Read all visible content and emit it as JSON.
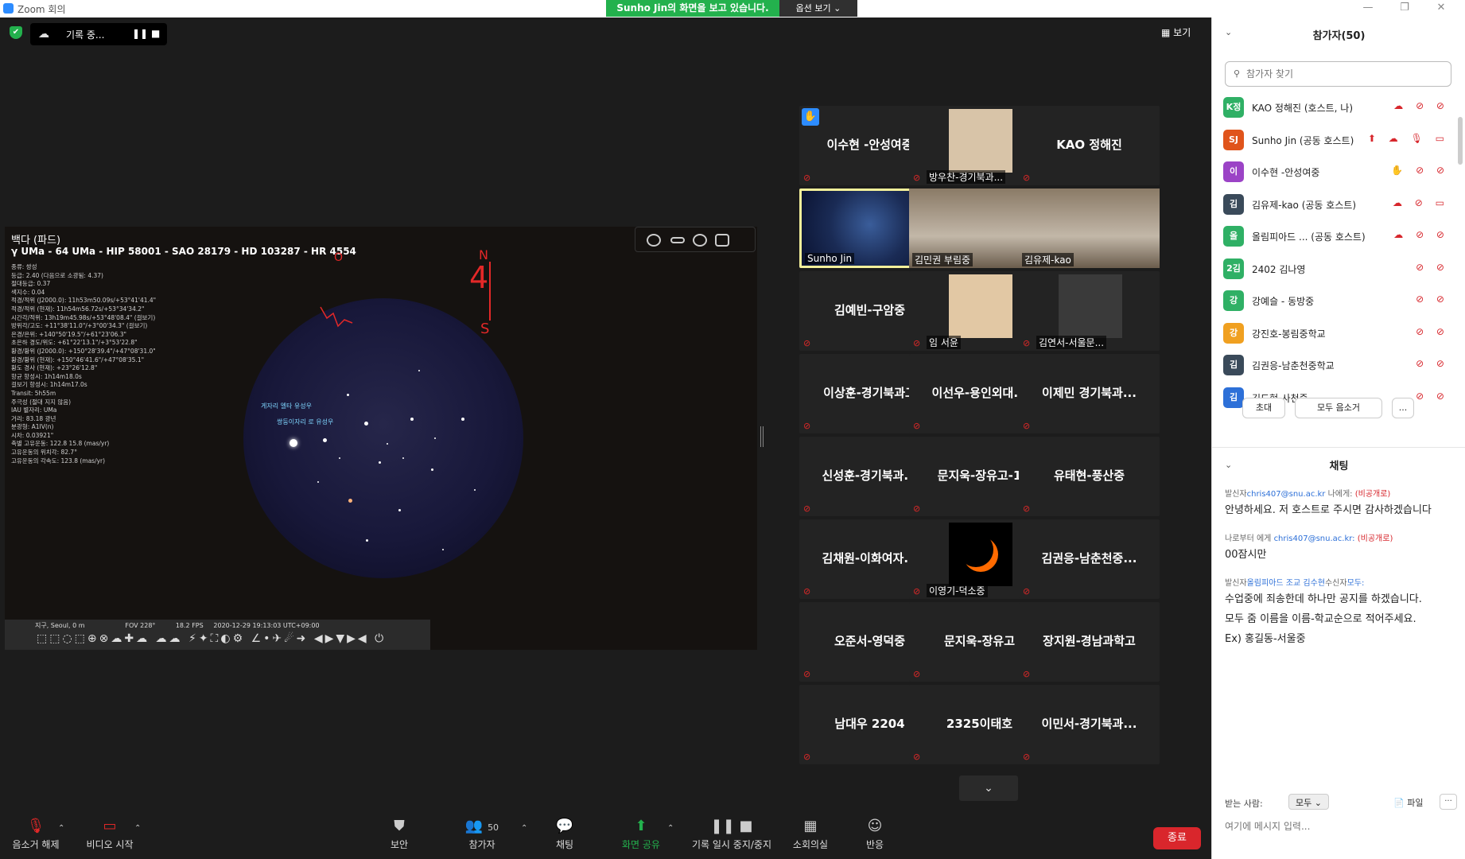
{
  "window": {
    "title": "Zoom 회의",
    "share_banner": "Sunho Jin의 화면을 보고 있습니다.",
    "view_options": "옵션 보기 ⌄",
    "minimize_glyph": "—",
    "restore_glyph": "❐",
    "close_glyph": "✕"
  },
  "recording": {
    "label": "기록 중...",
    "pause_glyph": "❚❚",
    "stop_glyph": "■"
  },
  "view_button": "보기",
  "shared_screen": {
    "object_title": "백다 (파드)",
    "object_ids": "γ UMa - 64 UMa - HIP 58001 - SAO 28179 - HD 103287 - HR 4554",
    "info_lines": [
      "종류: 쌍성",
      "등급: 2.40 (다음으로 소광됨: 4.37)",
      "절대등급: 0.37",
      "색지수: 0.04",
      "적경/적위 (J2000.0): 11h53m50.09s/+53°41'41.4\"",
      "적경/적위 (현재): 11h54m56.72s/+53°34'34.2\"",
      "시간각/적위: 13h19m45.98s/+53°48'08.4\" (걸보기)",
      "방위각/고도: +11°38'11.0\"/+3°00'34.3\" (걸보기)",
      "은경/은위: +140°50'19.5\"/+61°23'06.3\"",
      "초은하 경도/위도: +61°22'13.1\"/+3°53'22.8\"",
      "황경/황위 (J2000.0): +150°28'39.4\"/+47°08'31.0\"",
      "황경/황위 (현재): +150°46'41.6\"/+47°08'35.1\"",
      "황도 경사 (현재): +23°26'12.8\"",
      "항균 항성시: 1h14m18.0s",
      "걸보기 항성시: 1h14m17.0s",
      "Transit: 5h55m",
      "주극성 (절대 지지 않음)",
      "IAU 별자리: UMa",
      "거리: 83.18 광년",
      "분광형: A1IV(n)",
      "시차: 0.03921\"",
      "축별 고유운동: 122.8 15.8 (mas/yr)",
      "고유운동의 위치각: 82.7°",
      "고유운동의 각속도: 123.8 (mas/yr)"
    ],
    "sky_label_1": "게자리 엘타 유성우",
    "sky_label_2": "쌍둥이자리 로 유성우",
    "status_bar": "지구, Seoul, 0 m                    FOV 228°          18.2 FPS     2020-12-29 19:13:03 UTC+09:00",
    "toolbar_glyphs": "⬚⬚◌⬚⊕⊗☁✚☁ ☁☁ ⚡✦⛶◐⚙ ∠•✈☄➜ ◀▶▼▶◀ ⏻",
    "annotations": {
      "north": "N",
      "south": "S",
      "o_mark": "O",
      "four_mark": "4"
    }
  },
  "tiles": [
    {
      "name": "이수현 -안성여중",
      "raise_hand": "✋"
    },
    {
      "name": "방우찬-경기북과..."
    },
    {
      "name": "KAO 정해진"
    },
    {
      "name": "Sunho Jin"
    },
    {
      "name": "김민권 부림중"
    },
    {
      "name": "김유제-kao"
    },
    {
      "name": "김예빈-구암중"
    },
    {
      "name": "임 서윤"
    },
    {
      "name": "김연서-서울문..."
    },
    {
      "name": "이상훈-경기북과고"
    },
    {
      "name": "이선우-용인외대..."
    },
    {
      "name": "이제민 경기북과..."
    },
    {
      "name": "신성훈-경기북과..."
    },
    {
      "name": "문지욱-장유고-1"
    },
    {
      "name": "유태현-풍산중"
    },
    {
      "name": "김채원-이화여자..."
    },
    {
      "name": "이영기-덕소중"
    },
    {
      "name": "김권응-남춘천중..."
    },
    {
      "name": "오준서-영덕중"
    },
    {
      "name": "문지욱-장유고"
    },
    {
      "name": "장지원-경남과학고"
    },
    {
      "name": "남대우 2204"
    },
    {
      "name": "2325이태호"
    },
    {
      "name": "이민서-경기북과..."
    }
  ],
  "tile_mic_glyph": "⊘",
  "scroll_down_glyph": "⌄",
  "toolbar": {
    "unmute": "음소거 해제",
    "start_video": "비디오 시작",
    "security": "보안",
    "participants": "참가자",
    "participants_count": "50",
    "chat": "채팅",
    "share": "화면 공유",
    "record_pause": "기록 일시 중지/중지",
    "breakout": "소회의실",
    "reactions": "반응",
    "end": "종료",
    "caret": "⌃"
  },
  "participants_panel": {
    "header": "참가자(50)",
    "collapse_glyph": "⌄",
    "search_placeholder": "참가자 찾기",
    "participants": [
      {
        "initials": "K정",
        "name": "KAO 정해진 (호스트, 나)",
        "color": "#2fb065",
        "icons": "☁ ⊘ ⊘"
      },
      {
        "initials": "SJ",
        "name": "Sunho Jin (공동 호스트)",
        "color": "#e0541b",
        "icons": "⬆ ☁ 🎙 ▭"
      },
      {
        "initials": "이",
        "name": "이수현 -안성여중",
        "color": "#9b43c6",
        "icons": "✋ ⊘ ⊘"
      },
      {
        "initials": "김",
        "name": "김유제-kao (공동 호스트)",
        "color": "#3a4a5a",
        "icons": "☁ ⊘ ▭"
      },
      {
        "initials": "올",
        "name": "올림피아드 ...  (공동 호스트)",
        "color": "#2fb065",
        "icons": "☁ ⊘ ⊘"
      },
      {
        "initials": "2김",
        "name": "2402 김나영",
        "color": "#2fb065",
        "icons": "⊘ ⊘"
      },
      {
        "initials": "강",
        "name": "강예슬 - 동방중",
        "color": "#2fb065",
        "icons": "⊘ ⊘"
      },
      {
        "initials": "강",
        "name": "강진호-봉림중학교",
        "color": "#f0a020",
        "icons": "⊘ ⊘"
      },
      {
        "initials": "김",
        "name": "김권응-남춘천중학교",
        "color": "#3a4a5a",
        "icons": "⊘ ⊘"
      },
      {
        "initials": "김",
        "name": "김도현-사천중",
        "color": "#2d70d8",
        "icons": "⊘ ⊘"
      }
    ],
    "invite": "초대",
    "mute_all": "모두 음소거",
    "more": "..."
  },
  "chat_panel": {
    "header": "채팅",
    "collapse_glyph": "⌄",
    "messages": [
      {
        "meta_prefix": "발신자",
        "sender": "chris407@snu.ac.kr",
        "meta_mid": " 나에게: ",
        "privacy": "(비공개로)",
        "text": "안녕하세요. 저 호스트로 주시면 감사하겠습니다"
      },
      {
        "meta_prefix": "나로부터 에게 ",
        "sender": "chris407@snu.ac.kr:",
        "meta_mid": " ",
        "privacy": "(비공개로)",
        "text": "00잠시만"
      },
      {
        "meta_prefix": "발신자",
        "sender": "올림피아드 조교 김수현",
        "meta_mid": "수신자",
        "privacy": "모두:",
        "text": "수업중에 죄송한데 하나만 공지를 하겠습니다.\n모두 줌 이름을 이름-학교순으로 적어주세요.\nEx) 홍길동-서울중"
      }
    ],
    "to_label": "받는 사람:",
    "to_value": "모두 ⌄",
    "file": "📄 파일",
    "more": "···",
    "input_placeholder": "여기에 메시지 입력..."
  }
}
